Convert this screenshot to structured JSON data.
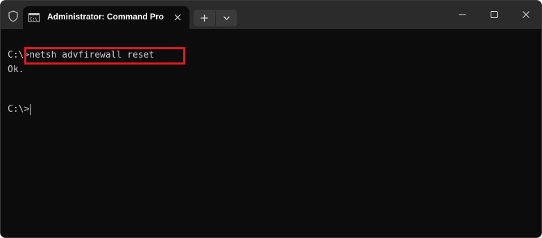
{
  "window": {
    "tab_title": "Administrator: Command Pro",
    "controls": {
      "minimize": "minimize-icon",
      "maximize": "maximize-icon",
      "close": "close-icon"
    },
    "colors": {
      "titlebar": "#2b2b2b",
      "console_bg": "#0c0c0c",
      "console_text": "#cccccc",
      "highlight_border": "#e01b24"
    }
  },
  "console": {
    "prompt1": "C:\\>",
    "command": "netsh advfirewall reset",
    "output": "Ok.",
    "prompt2": "C:\\>"
  }
}
